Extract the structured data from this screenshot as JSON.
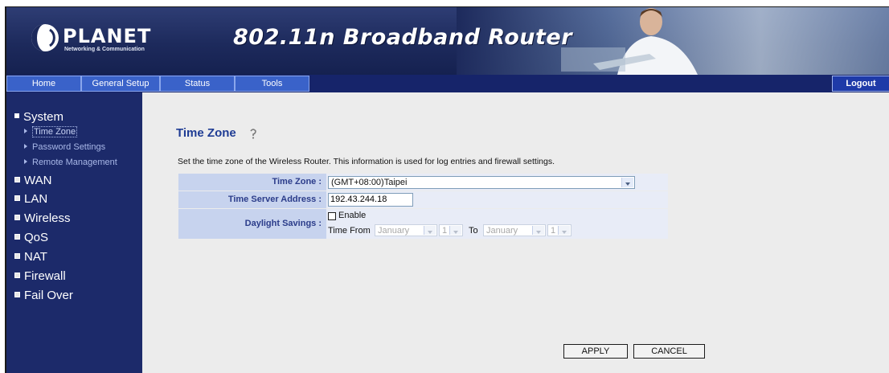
{
  "header": {
    "logo_text": "PLANET",
    "logo_tagline": "Networking & Communication",
    "product_title": "802.11n Broadband Router"
  },
  "nav": {
    "home": "Home",
    "general_setup": "General Setup",
    "status": "Status",
    "tools": "Tools",
    "logout": "Logout"
  },
  "sidebar": {
    "system": "System",
    "system_items": [
      "Time Zone",
      "Password Settings",
      "Remote Management"
    ],
    "wan": "WAN",
    "lan": "LAN",
    "wireless": "Wireless",
    "qos": "QoS",
    "nat": "NAT",
    "firewall": "Firewall",
    "fail_over": "Fail Over"
  },
  "main": {
    "title": "Time Zone",
    "description": "Set the time zone of the Wireless Router. This information is used for log entries and firewall settings.",
    "time_zone_label": "Time Zone :",
    "time_zone_value": "(GMT+08:00)Taipei",
    "time_server_label": "Time Server Address :",
    "time_server_value": "192.43.244.18",
    "daylight_label": "Daylight Savings :",
    "enable_label": "Enable",
    "enable_checked": false,
    "time_from_label": "Time From",
    "from_month": "January",
    "from_day": "1",
    "to_label": "To",
    "to_month": "January",
    "to_day": "1",
    "apply_label": "APPLY",
    "cancel_label": "CANCEL"
  },
  "colors": {
    "nav_bar": "#16246a",
    "nav_tab": "#3a62c9",
    "sidebar": "#1c2a6a",
    "content_bg": "#ececec",
    "title": "#1f3c94"
  }
}
